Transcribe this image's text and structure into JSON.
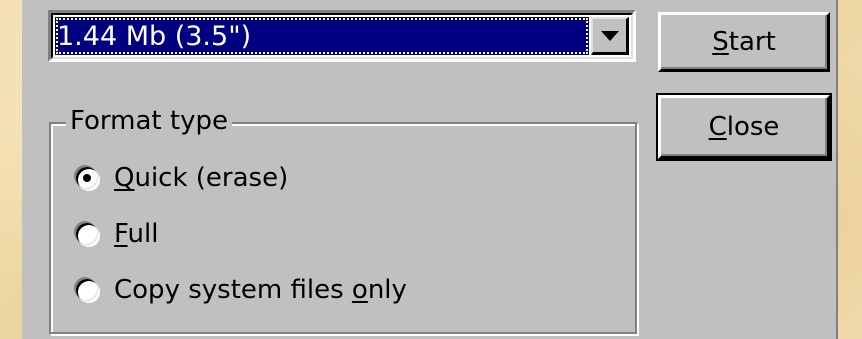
{
  "capacity": {
    "selected": "1.44 Mb (3.5\")"
  },
  "buttons": {
    "start": {
      "mnemonic": "S",
      "rest": "tart"
    },
    "close": {
      "mnemonic": "C",
      "rest": "lose"
    }
  },
  "format_type": {
    "title": "Format type",
    "options": [
      {
        "before": "",
        "mnemonic": "Q",
        "after": "uick (erase)",
        "checked": true
      },
      {
        "before": "",
        "mnemonic": "F",
        "after": "ull",
        "checked": false
      },
      {
        "before": "Copy system files ",
        "mnemonic": "o",
        "after": "nly",
        "checked": false
      }
    ]
  },
  "icons": {
    "combo_arrow": "chevron-down-icon"
  }
}
